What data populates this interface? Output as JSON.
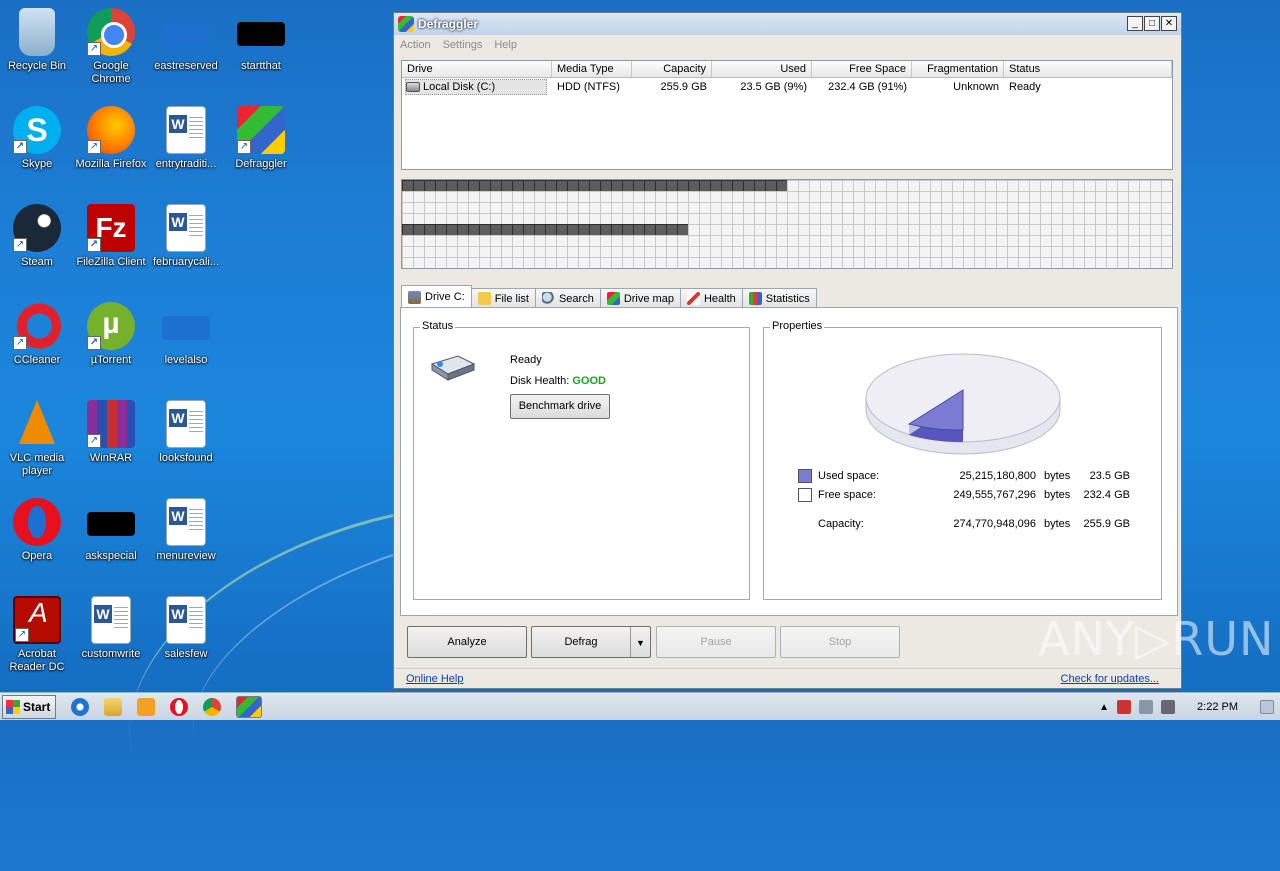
{
  "desktop": {
    "icons": [
      {
        "label": "Recycle Bin"
      },
      {
        "label": "Google Chrome"
      },
      {
        "label": "eastreserved"
      },
      {
        "label": "startthat"
      },
      {
        "label": "Skype"
      },
      {
        "label": "Mozilla Firefox"
      },
      {
        "label": "entrytraditi..."
      },
      {
        "label": "Defraggler"
      },
      {
        "label": "Steam"
      },
      {
        "label": "FileZilla Client"
      },
      {
        "label": "februarycali..."
      },
      {
        "label": "CCleaner"
      },
      {
        "label": "µTorrent"
      },
      {
        "label": "levelalso"
      },
      {
        "label": "VLC media player"
      },
      {
        "label": "WinRAR"
      },
      {
        "label": "looksfound"
      },
      {
        "label": "Opera"
      },
      {
        "label": "askspecial"
      },
      {
        "label": "menureview"
      },
      {
        "label": "Acrobat Reader DC"
      },
      {
        "label": "customwrite"
      },
      {
        "label": "salesfew"
      }
    ]
  },
  "window": {
    "title": "Defraggler",
    "menu": [
      "Action",
      "Settings",
      "Help"
    ],
    "columns": [
      "Drive",
      "Media Type",
      "Capacity",
      "Used",
      "Free Space",
      "Fragmentation",
      "Status"
    ],
    "drives": [
      {
        "drive": "Local Disk (C:)",
        "media": "HDD (NTFS)",
        "capacity": "255.9 GB",
        "used": "23.5 GB (9%)",
        "free": "232.4 GB (91%)",
        "frag": "Unknown",
        "status": "Ready"
      }
    ],
    "tabs": [
      "Drive C:",
      "File list",
      "Search",
      "Drive map",
      "Health",
      "Statistics"
    ],
    "status_group": {
      "title": "Status",
      "state": "Ready",
      "health_label": "Disk Health:",
      "health_value": "GOOD",
      "benchmark": "Benchmark drive"
    },
    "properties": {
      "title": "Properties",
      "used_label": "Used space:",
      "used_bytes": "25,215,180,800",
      "used_unit": "bytes",
      "used_gb": "23.5 GB",
      "free_label": "Free space:",
      "free_bytes": "249,555,767,296",
      "free_unit": "bytes",
      "free_gb": "232.4 GB",
      "cap_label": "Capacity:",
      "cap_bytes": "274,770,948,096",
      "cap_unit": "bytes",
      "cap_gb": "255.9 GB",
      "used_color": "#7b7bd4"
    },
    "buttons": {
      "analyze": "Analyze",
      "defrag": "Defrag",
      "pause": "Pause",
      "stop": "Stop"
    },
    "footer": {
      "online_help": "Online Help",
      "updates": "Check for updates..."
    }
  },
  "taskbar": {
    "start": "Start",
    "time": "2:22 PM"
  },
  "watermark": "ANY▷RUN"
}
